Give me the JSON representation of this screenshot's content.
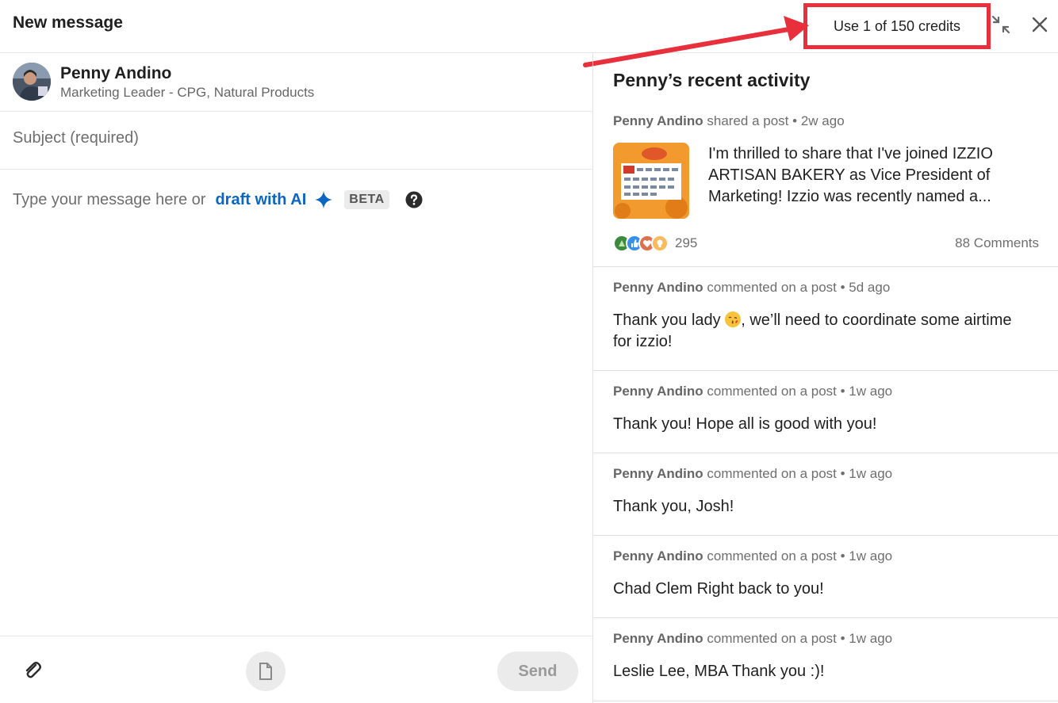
{
  "header": {
    "title": "New message",
    "credits": "Use 1 of 150 credits"
  },
  "recipient": {
    "name": "Penny Andino",
    "headline": "Marketing Leader - CPG, Natural Products"
  },
  "compose": {
    "subject_placeholder": "Subject (required)",
    "message_placeholder": "Type your message here or",
    "draft_link": "draft with AI",
    "beta_label": "BETA"
  },
  "footer": {
    "send_label": "Send"
  },
  "activity": {
    "title": "Penny’s recent activity",
    "post": {
      "author": "Penny Andino",
      "action": "shared a post",
      "time": "2w ago",
      "text": "I'm thrilled to share that I've joined IZZIO ARTISAN BAKERY as Vice President of Marketing! Izzio was recently named a...",
      "reactions_count": "295",
      "comments_count": "88 Comments"
    },
    "comments": [
      {
        "author": "Penny Andino",
        "action": "commented on a post",
        "time": "5d ago",
        "text_before": "Thank you lady ",
        "text_after": ", we’ll need to coordinate some airtime for izzio!"
      },
      {
        "author": "Penny Andino",
        "action": "commented on a post",
        "time": "1w ago",
        "text": "Thank you! Hope all is good with you!"
      },
      {
        "author": "Penny Andino",
        "action": "commented on a post",
        "time": "1w ago",
        "text": "Thank you, Josh!"
      },
      {
        "author": "Penny Andino",
        "action": "commented on a post",
        "time": "1w ago",
        "text": "Chad Clem Right back to you!"
      },
      {
        "author": "Penny Andino",
        "action": "commented on a post",
        "time": "1w ago",
        "text": "Leslie Lee, MBA Thank you :)!"
      }
    ]
  },
  "colors": {
    "accent": "#0a66c2",
    "annotation": "#e8303d"
  }
}
